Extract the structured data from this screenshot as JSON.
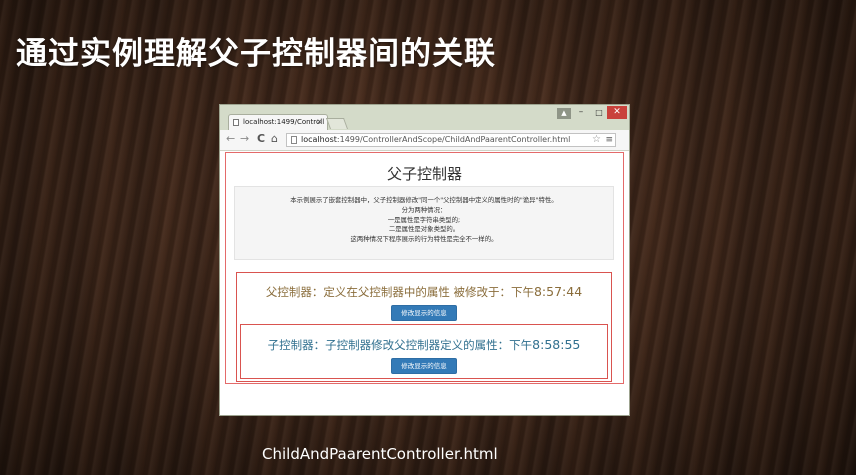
{
  "slide": {
    "title": "通过实例理解父子控制器间的关联",
    "caption": "ChildAndPaarentController.html"
  },
  "browser": {
    "tab_title": "localhost:1499/Controll",
    "tab_close": "×",
    "url_host": "localhost",
    "url_path": ":1499/ControllerAndScope/ChildAndPaarentController.html",
    "nav": {
      "back": "←",
      "forward": "→",
      "reload": "C",
      "home": "⌂"
    },
    "window_controls": {
      "user": "▲",
      "minimize": "–",
      "maximize": "□",
      "close": "✕"
    },
    "star": "☆",
    "menu": "≡"
  },
  "page": {
    "heading": "父子控制器",
    "info_lines": [
      "本示例展示了嵌套控制器中，父子控制器修改\"同一个\"父控制器中定义的属性时的\"诡异\"特性。",
      "分为两种情况：",
      "一是属性是字符串类型的;",
      "二是属性是对象类型的。",
      "这两种情况下程序展示的行为特性是完全不一样的。"
    ],
    "parent": {
      "text": "父控制器：定义在父控制器中的属性 被修改于：下午",
      "time": "8:57:44",
      "button": "修改显示的信息"
    },
    "child": {
      "text": "子控制器：子控制器修改父控制器定义的属性：下午",
      "time": "8:58:55",
      "button": "修改显示的信息"
    }
  },
  "colors": {
    "border_red": "#d9534f",
    "parent_text": "#8a6d3b",
    "child_text": "#31708f",
    "button_blue": "#337ab7"
  }
}
